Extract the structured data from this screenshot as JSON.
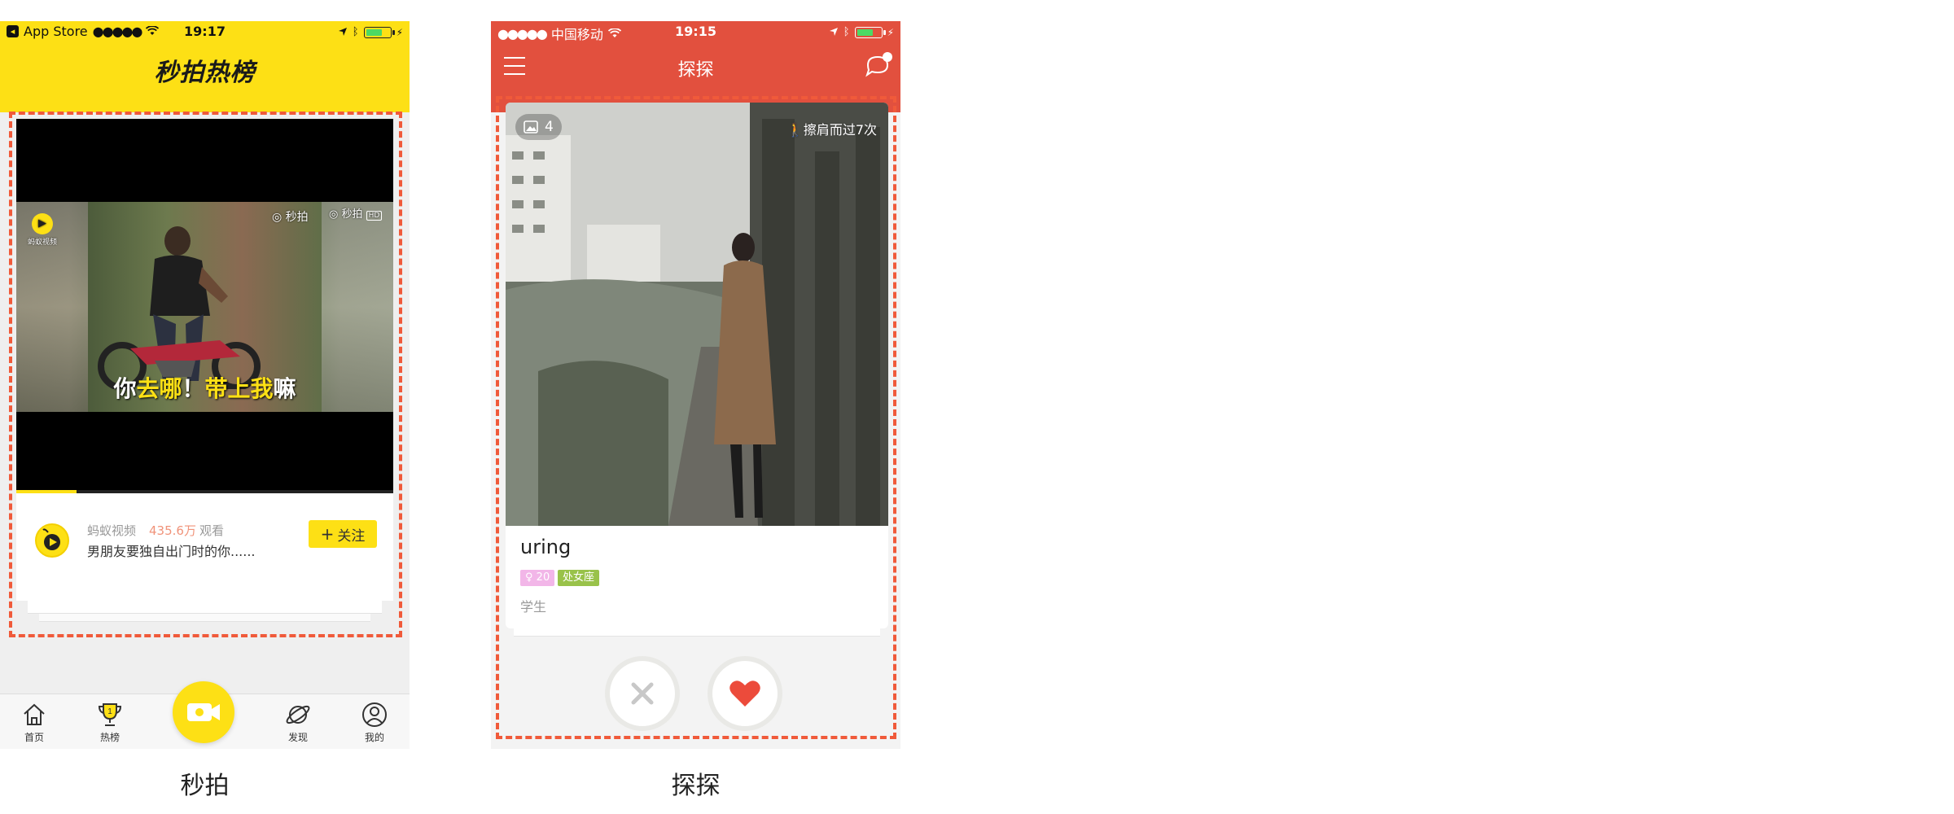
{
  "miaopai": {
    "status": {
      "carrier": "App Store",
      "time": "19:17"
    },
    "nav_title": "秒拍热榜",
    "video": {
      "caption_parts": [
        "你",
        "去哪",
        "！",
        "带上我",
        "嘛"
      ],
      "watermark_left": "蚂蚁视频",
      "watermark_mid": "秒拍",
      "watermark_right": "秒拍",
      "watermark_hd": "HD",
      "progress_fraction": 0.16
    },
    "card": {
      "channel": "蚂蚁视频",
      "views": "435.6万",
      "views_suffix": "观看",
      "description": "男朋友要独自出门时的你......",
      "follow_label": "关注"
    },
    "tabs": [
      {
        "label": "首页",
        "icon": "home-icon"
      },
      {
        "label": "热榜",
        "icon": "trophy-icon",
        "badge": "1"
      },
      {
        "label": "发现",
        "icon": "planet-icon"
      },
      {
        "label": "我的",
        "icon": "user-icon"
      }
    ],
    "center_button_icon": "video-camera-icon",
    "app_name": "秒拍"
  },
  "tantan": {
    "status": {
      "carrier": "中国移动",
      "time": "19:15"
    },
    "nav_title": "探探",
    "photo_count": "4",
    "passed_text": "擦肩而过7次",
    "profile": {
      "name": "uring",
      "age": "20",
      "zodiac": "处女座",
      "job": "学生"
    },
    "buttons": {
      "dislike_icon": "close-icon",
      "like_icon": "heart-icon"
    },
    "app_name": "探探"
  },
  "colors": {
    "miaopai_yellow": "#fde015",
    "tantan_red": "#e2503e",
    "dashed_border": "#f05a3a"
  }
}
